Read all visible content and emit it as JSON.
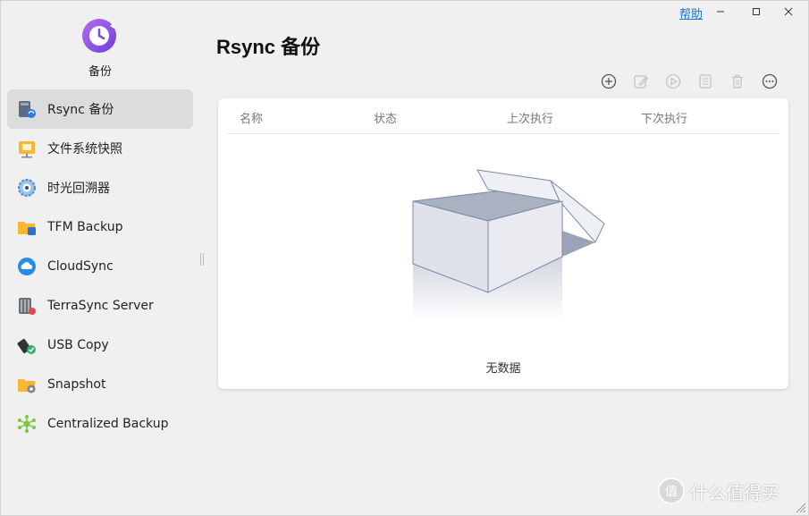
{
  "window": {
    "help_label": "帮助",
    "minimize": "–",
    "maximize": "□",
    "close": "✕"
  },
  "app": {
    "name": "备份",
    "logo_icon": "backup-clock-icon",
    "accent": "#8b4fe0"
  },
  "sidebar": {
    "items": [
      {
        "label": "Rsync 备份",
        "icon": "rsync-icon",
        "active": true
      },
      {
        "label": "文件系统快照",
        "icon": "snapshot-folder-icon"
      },
      {
        "label": "时光回溯器",
        "icon": "time-machine-icon"
      },
      {
        "label": "TFM Backup",
        "icon": "tfm-folder-icon"
      },
      {
        "label": "CloudSync",
        "icon": "cloud-icon"
      },
      {
        "label": "TerraSync Server",
        "icon": "server-icon"
      },
      {
        "label": "USB Copy",
        "icon": "usb-icon"
      },
      {
        "label": "Snapshot",
        "icon": "snapshot-camera-folder-icon"
      },
      {
        "label": "Centralized Backup",
        "icon": "network-icon"
      }
    ]
  },
  "main": {
    "title": "Rsync 备份",
    "toolbar": [
      "add-icon",
      "edit-icon",
      "run-icon",
      "log-icon",
      "delete-icon",
      "more-icon"
    ],
    "table": {
      "columns": [
        "名称",
        "状态",
        "上次执行",
        "下次执行"
      ],
      "rows": []
    },
    "empty_text": "无数据"
  },
  "watermark": {
    "text": "什么值得买",
    "badge": "值"
  }
}
